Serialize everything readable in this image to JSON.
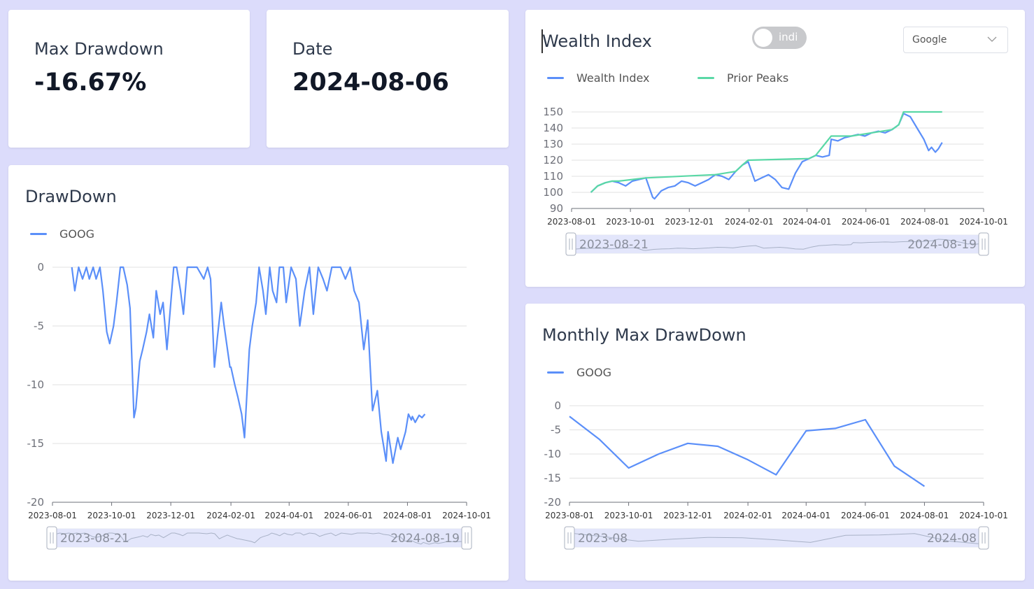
{
  "stats": {
    "max_drawdown_label": "Max Drawdown",
    "max_drawdown_value": "-16.67%",
    "date_label": "Date",
    "date_value": "2024-08-06"
  },
  "wealth": {
    "title": "Wealth Index",
    "toggle_label": "indi",
    "toggle_on": false,
    "select_value": "Google",
    "legend": [
      "Wealth Index",
      "Prior Peaks"
    ]
  },
  "drawdown": {
    "title": "DrawDown",
    "legend": [
      "GOOG"
    ]
  },
  "monthly": {
    "title": "Monthly Max DrawDown",
    "legend": [
      "GOOG"
    ]
  },
  "colors": {
    "series_blue": "#5b8ff9",
    "series_green": "#5ad8a6",
    "zoom_fill": "#dfe3fa",
    "background": "#dcdcfb"
  },
  "chart_data": [
    {
      "type": "line",
      "name": "wealth-index",
      "title": "Wealth Index",
      "x_ticks": [
        "2023-08-01",
        "2023-10-01",
        "2023-12-01",
        "2024-02-01",
        "2024-04-01",
        "2024-06-01",
        "2024-08-01",
        "2024-10-01"
      ],
      "ylim": [
        90,
        150
      ],
      "y_ticks": [
        90,
        100,
        110,
        120,
        130,
        140,
        150
      ],
      "series": [
        {
          "name": "Wealth Index",
          "color": "#5b8ff9",
          "x": [
            "2023-08-21",
            "2023-08-28",
            "2023-09-05",
            "2023-09-12",
            "2023-09-19",
            "2023-09-26",
            "2023-10-03",
            "2023-10-10",
            "2023-10-17",
            "2023-10-24",
            "2023-10-26",
            "2023-11-02",
            "2023-11-09",
            "2023-11-16",
            "2023-11-23",
            "2023-11-30",
            "2023-12-07",
            "2023-12-14",
            "2023-12-21",
            "2023-12-28",
            "2024-01-04",
            "2024-01-11",
            "2024-01-18",
            "2024-01-25",
            "2024-01-31",
            "2024-02-07",
            "2024-02-14",
            "2024-02-21",
            "2024-02-28",
            "2024-03-06",
            "2024-03-13",
            "2024-03-20",
            "2024-03-27",
            "2024-04-03",
            "2024-04-10",
            "2024-04-17",
            "2024-04-24",
            "2024-04-26",
            "2024-05-03",
            "2024-05-10",
            "2024-05-17",
            "2024-05-24",
            "2024-05-31",
            "2024-06-07",
            "2024-06-14",
            "2024-06-21",
            "2024-06-28",
            "2024-07-05",
            "2024-07-10",
            "2024-07-17",
            "2024-07-24",
            "2024-07-31",
            "2024-08-05",
            "2024-08-08",
            "2024-08-12",
            "2024-08-15",
            "2024-08-19"
          ],
          "y": [
            100,
            104,
            106,
            107,
            106,
            104,
            107,
            108,
            109,
            97,
            96,
            101,
            103,
            104,
            107,
            106,
            104,
            106,
            108,
            111,
            110,
            108,
            113,
            117,
            119,
            107,
            109,
            111,
            108,
            103,
            102,
            112,
            119,
            121,
            123,
            122,
            123,
            133,
            132,
            134,
            135,
            136,
            135,
            137,
            138,
            137,
            139,
            142,
            149,
            147,
            140,
            133,
            126,
            128,
            125,
            127,
            131
          ]
        },
        {
          "name": "Prior Peaks",
          "color": "#5ad8a6",
          "x": [
            "2023-08-21",
            "2023-08-28",
            "2023-09-05",
            "2023-09-12",
            "2023-09-19",
            "2023-10-17",
            "2023-12-28",
            "2024-01-18",
            "2024-01-25",
            "2024-01-31",
            "2024-04-03",
            "2024-04-10",
            "2024-04-26",
            "2024-05-17",
            "2024-06-28",
            "2024-07-05",
            "2024-07-10",
            "2024-08-19"
          ],
          "y": [
            100,
            104,
            106,
            107,
            107,
            109,
            111,
            113,
            117,
            120,
            121,
            123,
            135,
            135,
            139,
            142,
            150,
            150
          ]
        }
      ]
    },
    {
      "type": "line",
      "name": "drawdown",
      "title": "DrawDown",
      "x_ticks": [
        "2023-08-01",
        "2023-10-01",
        "2023-12-01",
        "2024-02-01",
        "2024-04-01",
        "2024-06-01",
        "2024-08-01",
        "2024-10-01"
      ],
      "ylim": [
        -20,
        0
      ],
      "y_ticks": [
        0,
        -5,
        -10,
        -15,
        -20
      ],
      "series": [
        {
          "name": "GOOG",
          "color": "#5b8ff9",
          "x": [
            "2023-08-21",
            "2023-08-24",
            "2023-08-28",
            "2023-09-01",
            "2023-09-05",
            "2023-09-08",
            "2023-09-12",
            "2023-09-15",
            "2023-09-19",
            "2023-09-22",
            "2023-09-26",
            "2023-09-29",
            "2023-10-03",
            "2023-10-06",
            "2023-10-10",
            "2023-10-13",
            "2023-10-17",
            "2023-10-20",
            "2023-10-24",
            "2023-10-26",
            "2023-10-30",
            "2023-11-02",
            "2023-11-06",
            "2023-11-09",
            "2023-11-13",
            "2023-11-16",
            "2023-11-20",
            "2023-11-23",
            "2023-11-27",
            "2023-11-30",
            "2023-12-04",
            "2023-12-07",
            "2023-12-11",
            "2023-12-14",
            "2023-12-18",
            "2023-12-21",
            "2023-12-28",
            "2024-01-04",
            "2024-01-08",
            "2024-01-11",
            "2024-01-15",
            "2024-01-18",
            "2024-01-22",
            "2024-01-25",
            "2024-01-31",
            "2024-02-01",
            "2024-02-05",
            "2024-02-08",
            "2024-02-12",
            "2024-02-15",
            "2024-02-20",
            "2024-02-23",
            "2024-02-27",
            "2024-03-01",
            "2024-03-05",
            "2024-03-08",
            "2024-03-12",
            "2024-03-15",
            "2024-03-19",
            "2024-03-22",
            "2024-03-26",
            "2024-03-29",
            "2024-04-03",
            "2024-04-08",
            "2024-04-12",
            "2024-04-17",
            "2024-04-22",
            "2024-04-26",
            "2024-05-01",
            "2024-05-06",
            "2024-05-10",
            "2024-05-15",
            "2024-05-20",
            "2024-05-24",
            "2024-05-29",
            "2024-06-03",
            "2024-06-07",
            "2024-06-12",
            "2024-06-17",
            "2024-06-21",
            "2024-06-26",
            "2024-07-01",
            "2024-07-05",
            "2024-07-10",
            "2024-07-12",
            "2024-07-17",
            "2024-07-22",
            "2024-07-25",
            "2024-07-30",
            "2024-08-02",
            "2024-08-05",
            "2024-08-06",
            "2024-08-09",
            "2024-08-13",
            "2024-08-16",
            "2024-08-19"
          ],
          "y": [
            0,
            -2,
            0,
            -1,
            0,
            -1,
            0,
            -1,
            0,
            -2,
            -5.5,
            -6.5,
            -5,
            -3,
            0,
            0,
            -1.5,
            -3.5,
            -12.8,
            -12,
            -8,
            -7,
            -5.5,
            -4,
            -6,
            -2,
            -4,
            -3,
            -7,
            -4,
            0,
            0,
            -2,
            -4,
            0,
            0,
            0,
            -1,
            0,
            -1,
            -8.5,
            -6,
            -3,
            -5,
            -8.5,
            -8.5,
            -10,
            -11,
            -12.5,
            -14.5,
            -7,
            -5,
            -3,
            0,
            -2,
            -4,
            0,
            -2,
            -3,
            0,
            0,
            -3,
            0,
            -1,
            -5,
            -2,
            0,
            -4,
            0,
            -1,
            -2,
            0,
            0,
            0,
            -1,
            0,
            -2,
            -3,
            -7,
            -4.5,
            -12.2,
            -10.5,
            -14,
            -16.5,
            -14,
            -16.67,
            -14.5,
            -15.5,
            -14,
            -12.5,
            -13,
            -12.7,
            -13.2,
            -12.6,
            -12.8,
            -12.5
          ]
        }
      ]
    },
    {
      "type": "line",
      "name": "monthly-max-drawdown",
      "title": "Monthly Max DrawDown",
      "x_ticks": [
        "2023-08-01",
        "2023-10-01",
        "2023-12-01",
        "2024-02-01",
        "2024-04-01",
        "2024-06-01",
        "2024-08-01",
        "2024-10-01"
      ],
      "ylim": [
        -20,
        0
      ],
      "y_ticks": [
        0,
        -5,
        -10,
        -15,
        -20
      ],
      "series": [
        {
          "name": "GOOG",
          "color": "#5b8ff9",
          "x": [
            "2023-08-01",
            "2023-09-01",
            "2023-10-01",
            "2023-11-01",
            "2023-12-01",
            "2024-01-01",
            "2024-02-01",
            "2024-03-01",
            "2024-04-01",
            "2024-05-01",
            "2024-06-01",
            "2024-07-01",
            "2024-08-01"
          ],
          "y": [
            -2.2,
            -7,
            -12.9,
            -10,
            -7.8,
            -8.4,
            -11.2,
            -14.3,
            -5.2,
            -4.7,
            -2.9,
            -12.5,
            -16.7
          ]
        }
      ]
    }
  ],
  "zooms": {
    "wealth": {
      "start": "2023-08-21",
      "end": "2024-08-19"
    },
    "drawdown": {
      "start": "2023-08-21",
      "end": "2024-08-19"
    },
    "monthly": {
      "start": "2023-08",
      "end": "2024-08"
    }
  }
}
